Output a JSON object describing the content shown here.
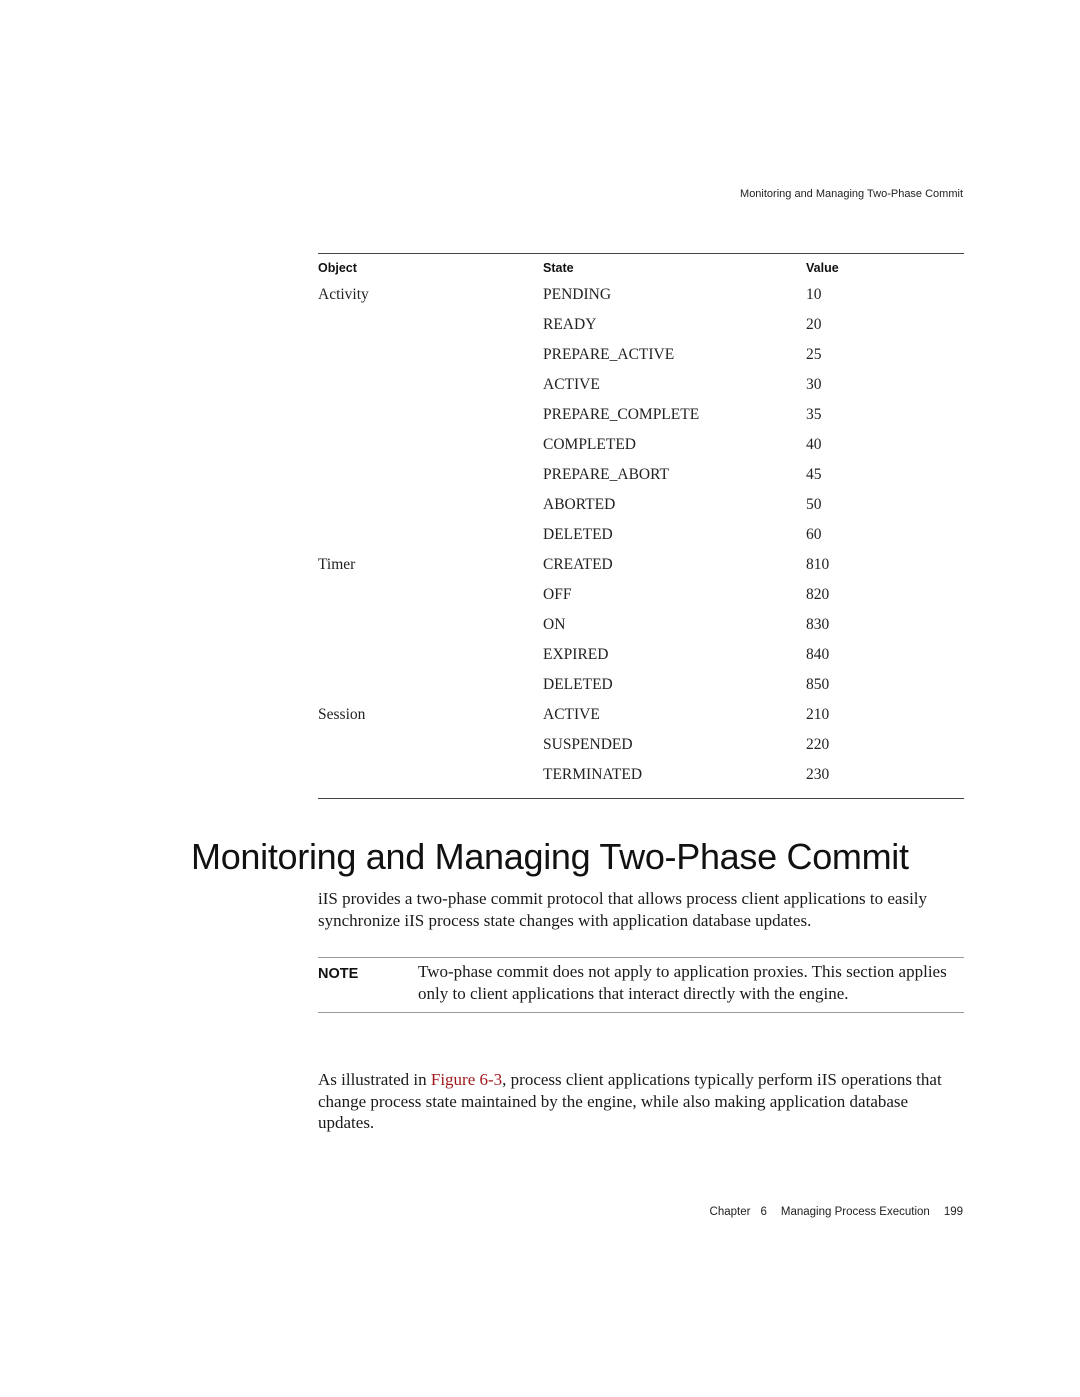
{
  "running_header": "Monitoring and Managing Two-Phase Commit",
  "table": {
    "headers": [
      "Object",
      "State",
      "Value"
    ],
    "rows": [
      {
        "object": "Activity",
        "state": "PENDING",
        "value": "10"
      },
      {
        "object": "",
        "state": "READY",
        "value": "20"
      },
      {
        "object": "",
        "state": "PREPARE_ACTIVE",
        "value": "25"
      },
      {
        "object": "",
        "state": "ACTIVE",
        "value": "30"
      },
      {
        "object": "",
        "state": "PREPARE_COMPLETE",
        "value": "35"
      },
      {
        "object": "",
        "state": "COMPLETED",
        "value": "40"
      },
      {
        "object": "",
        "state": "PREPARE_ABORT",
        "value": "45"
      },
      {
        "object": "",
        "state": "ABORTED",
        "value": "50"
      },
      {
        "object": "",
        "state": "DELETED",
        "value": "60"
      },
      {
        "object": "Timer",
        "state": "CREATED",
        "value": "810"
      },
      {
        "object": "",
        "state": "OFF",
        "value": "820"
      },
      {
        "object": "",
        "state": "ON",
        "value": "830"
      },
      {
        "object": "",
        "state": "EXPIRED",
        "value": "840"
      },
      {
        "object": "",
        "state": "DELETED",
        "value": "850"
      },
      {
        "object": "Session",
        "state": "ACTIVE",
        "value": "210"
      },
      {
        "object": "",
        "state": "SUSPENDED",
        "value": "220"
      },
      {
        "object": "",
        "state": "TERMINATED",
        "value": "230"
      }
    ]
  },
  "section": {
    "title": "Monitoring and Managing Two-Phase Commit",
    "intro": "iIS provides a two-phase commit protocol that allows process client applications to easily synchronize iIS process state changes with application database updates.",
    "note": {
      "label": "NOTE",
      "text": "Two-phase commit does not apply to application proxies. This section applies only to client applications that interact directly with the engine."
    },
    "para2": {
      "before_link": "As illustrated in ",
      "link_text": "Figure 6-3",
      "after_link": ", process client applications typically perform iIS operations that change process state maintained by the engine, while also making application database updates."
    }
  },
  "footer": {
    "chapter_label": "Chapter",
    "chapter_number": "6",
    "chapter_title": "Managing Process Execution",
    "page_number": "199"
  },
  "colors": {
    "link": "#a0181c"
  }
}
